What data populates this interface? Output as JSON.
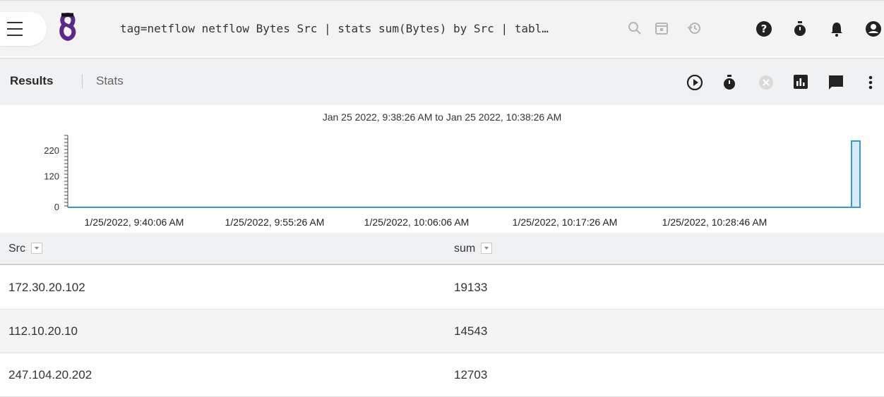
{
  "topbar": {
    "query": "tag=netflow netflow Bytes Src | stats sum(Bytes) by Src | tabl…",
    "icons": [
      "menu-icon",
      "gravwell-logo",
      "search-icon",
      "calendar-icon",
      "history-icon",
      "help-icon",
      "timer-icon",
      "bell-icon",
      "account-icon"
    ]
  },
  "results_bar": {
    "tab_results": "Results",
    "tab_stats": "Stats",
    "icons": [
      "play-circle-icon",
      "stopwatch-icon",
      "cancel-circle-icon",
      "bar-chart-icon",
      "comment-icon",
      "more-vert-icon"
    ]
  },
  "colors": {
    "accent": "#5b2a86",
    "chart_line": "#3a97d4",
    "chart_fill": "#d7ebf8"
  },
  "chart_data": {
    "type": "bar",
    "title": "Jan 25 2022, 9:38:26 AM to Jan 25 2022, 10:38:26 AM",
    "y_ticks": [
      "220",
      "120",
      "0"
    ],
    "x_ticks": [
      "1/25/2022, 9:40:06 AM",
      "1/25/2022, 9:55:26 AM",
      "1/25/2022, 10:06:06 AM",
      "1/25/2022, 10:17:26 AM",
      "1/25/2022, 10:28:46 AM"
    ],
    "ylim": [
      0,
      280
    ],
    "baseline_value": 0,
    "bars": [
      {
        "x": "1/25/2022, 10:38:26 AM",
        "value": 258
      }
    ]
  },
  "table": {
    "columns": [
      "Src",
      "sum"
    ],
    "rows": [
      [
        "172.30.20.102",
        "19133"
      ],
      [
        "112.10.20.10",
        "14543"
      ],
      [
        "247.104.20.202",
        "12703"
      ]
    ]
  }
}
